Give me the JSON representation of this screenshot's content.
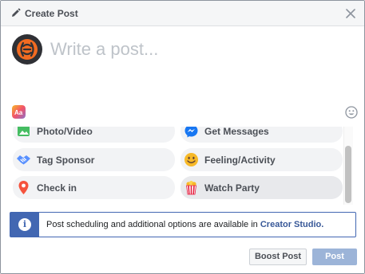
{
  "header": {
    "title": "Create Post",
    "pencil_icon": "pencil-icon",
    "close_icon": "close-icon"
  },
  "composer": {
    "placeholder": "Write a post...",
    "avatar_icon": "page-logo-icon",
    "background_icon": "text-background-icon",
    "emoji_icon": "emoji-icon"
  },
  "options": [
    {
      "label": "Photo/Video",
      "icon": "photo-icon"
    },
    {
      "label": "Get Messages",
      "icon": "messenger-icon"
    },
    {
      "label": "Tag Sponsor",
      "icon": "handshake-icon"
    },
    {
      "label": "Feeling/Activity",
      "icon": "smiley-icon"
    },
    {
      "label": "Check in",
      "icon": "location-pin-icon"
    },
    {
      "label": "Watch Party",
      "icon": "popcorn-icon"
    }
  ],
  "notice": {
    "text": "Post scheduling and additional options are available in",
    "link": "Creator Studio.",
    "icon": "info-icon"
  },
  "footer": {
    "boost_label": "Boost Post",
    "post_label": "Post"
  },
  "colors": {
    "accent": "#4267b2",
    "post_button_disabled": "#9cb4d8",
    "brand_orange": "#f26b21"
  }
}
